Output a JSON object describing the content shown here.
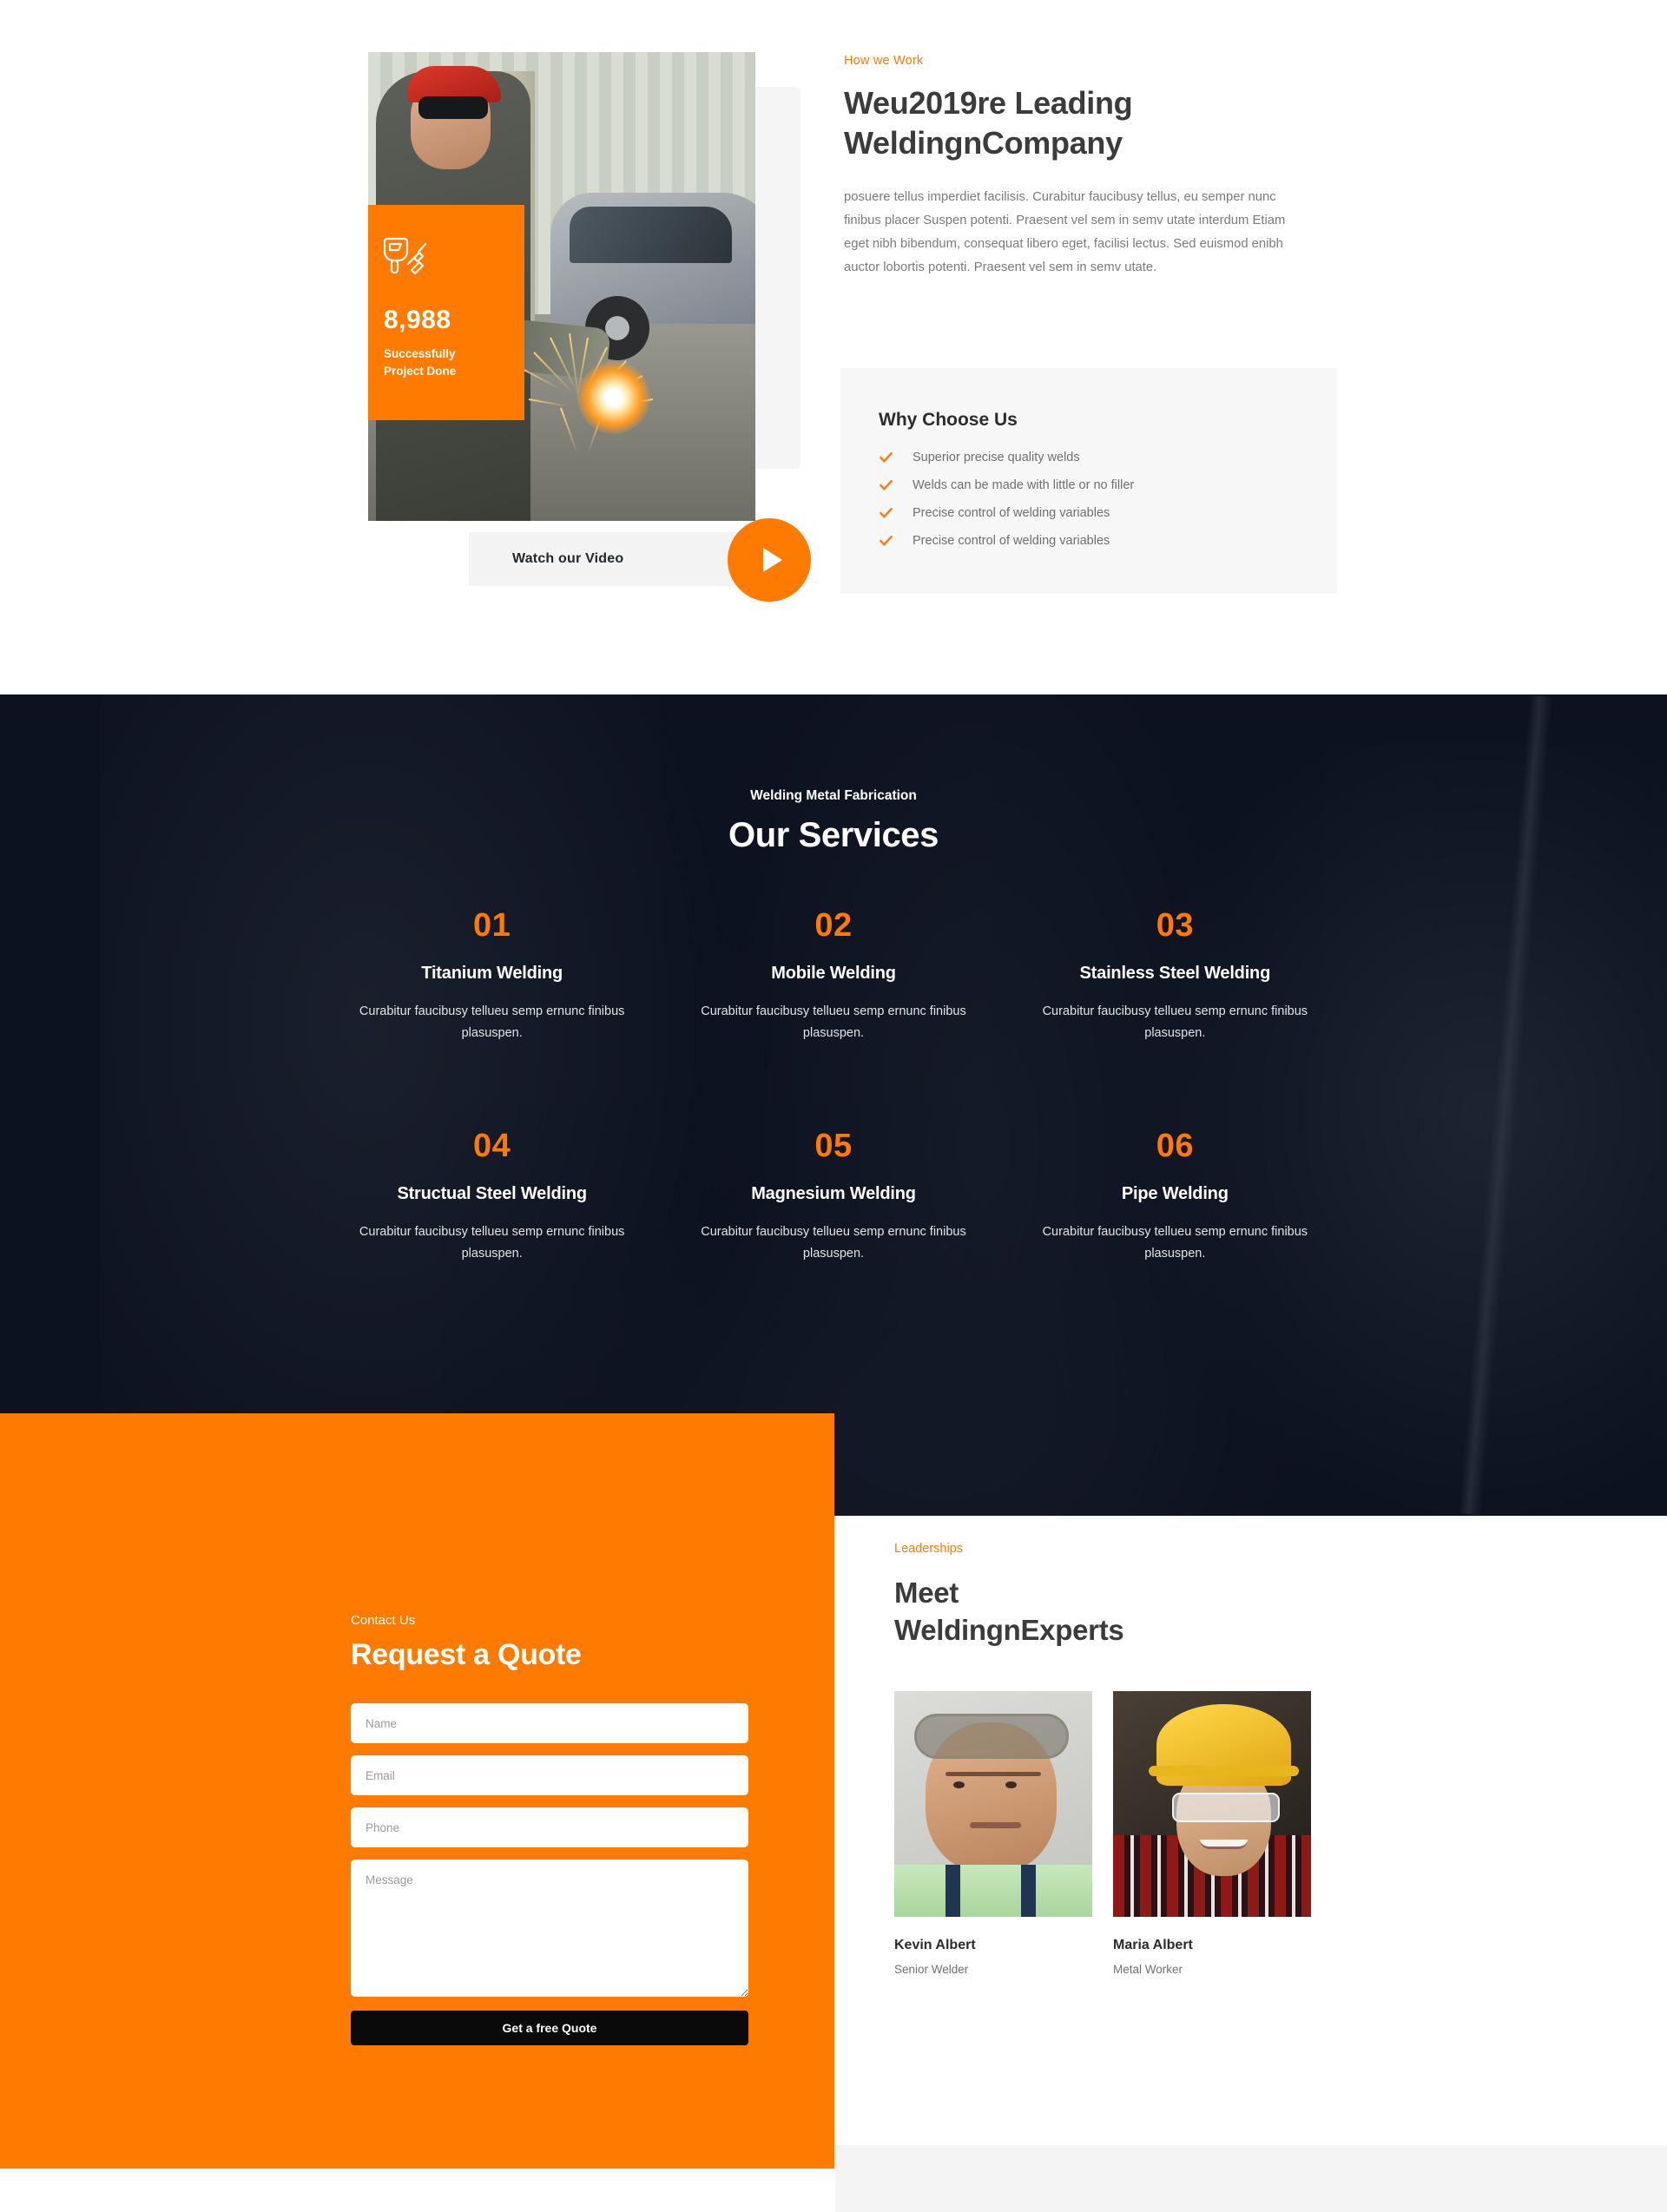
{
  "about": {
    "eyebrow": "How we Work",
    "heading": "Weu2019re Leading WeldingnCompany",
    "paragraph": "posuere tellus imperdiet facilisis. Curabitur faucibusy tellus, eu semper nunc finibus placer Suspen potenti. Praesent vel sem in semv utate interdum Etiam eget nibh bibendum, consequat libero eget, facilisi lectus. Sed euismod enibh auctor lobortis potenti. Praesent vel sem in semv utate.",
    "stat": {
      "icon": "welding-mask-torch-icon",
      "number": "8,988",
      "label_line1": "Successfully",
      "label_line2": "Project Done"
    },
    "video": {
      "label": "Watch our Video",
      "icon": "play-icon"
    },
    "why": {
      "title": "Why Choose Us",
      "items": [
        "Superior precise quality welds",
        "Welds can be made with little or no filler",
        "Precise control of welding variables",
        "Precise control of welding variables"
      ]
    }
  },
  "services": {
    "eyebrow": "Welding Metal Fabrication",
    "title": "Our Services",
    "items": [
      {
        "num": "01",
        "name": "Titanium Welding",
        "desc": "Curabitur faucibusy tellueu semp ernunc finibus plasuspen."
      },
      {
        "num": "02",
        "name": "Mobile Welding",
        "desc": "Curabitur faucibusy tellueu semp ernunc finibus plasuspen."
      },
      {
        "num": "03",
        "name": "Stainless Steel Welding",
        "desc": "Curabitur faucibusy tellueu semp ernunc finibus plasuspen."
      },
      {
        "num": "04",
        "name": "Structual Steel Welding",
        "desc": "Curabitur faucibusy tellueu semp ernunc finibus plasuspen."
      },
      {
        "num": "05",
        "name": "Magnesium Welding",
        "desc": "Curabitur faucibusy tellueu semp ernunc finibus plasuspen."
      },
      {
        "num": "06",
        "name": "Pipe Welding",
        "desc": "Curabitur faucibusy tellueu semp ernunc finibus plasuspen."
      }
    ]
  },
  "quote": {
    "eyebrow": "Contact Us",
    "title": "Request a Quote",
    "fields": {
      "name_placeholder": "Name",
      "email_placeholder": "Email",
      "phone_placeholder": "Phone",
      "message_placeholder": "Message"
    },
    "submit_label": "Get a free Quote"
  },
  "team": {
    "eyebrow": "Leaderships",
    "title": "Meet WeldingnExperts",
    "members": [
      {
        "name": "Kevin Albert",
        "role": "Senior Welder"
      },
      {
        "name": "Maria Albert",
        "role": "Metal Worker"
      }
    ]
  },
  "colors": {
    "accent": "#ff7a00",
    "dark": "#0d1220",
    "panel": "#f7f7f7",
    "strip": "#f4f4f4",
    "heading": "#3b3b3b",
    "body": "#7b7b7b"
  }
}
